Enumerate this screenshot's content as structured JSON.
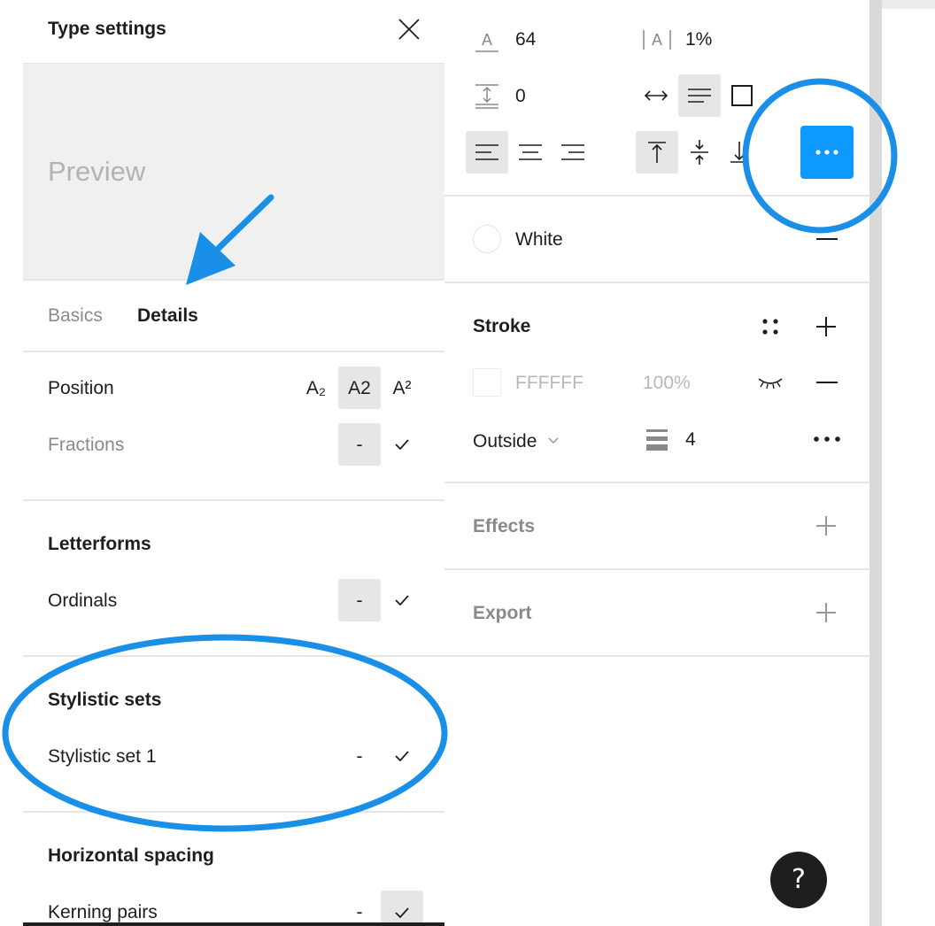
{
  "type_settings": {
    "title": "Type settings",
    "preview_text": "Preview",
    "tabs": [
      {
        "label": "Basics",
        "active": false
      },
      {
        "label": "Details",
        "active": true
      }
    ],
    "position": {
      "label": "Position",
      "options": [
        "A₂",
        "A2",
        "A²"
      ],
      "selected": "A2"
    },
    "fractions": {
      "label": "Fractions",
      "off": "-",
      "state": "off"
    },
    "letterforms": {
      "heading": "Letterforms",
      "ordinals": {
        "label": "Ordinals",
        "off": "-",
        "state": "off"
      }
    },
    "stylistic_sets": {
      "heading": "Stylistic sets",
      "set1": {
        "label": "Stylistic set 1",
        "off": "-",
        "state": "none"
      }
    },
    "horizontal_spacing": {
      "heading": "Horizontal spacing",
      "kerning_pairs": {
        "label": "Kerning pairs",
        "off": "-",
        "state": "on"
      }
    }
  },
  "text_props": {
    "font_size_value": "64",
    "letter_spacing_value": "1%",
    "line_height_value": "0",
    "auto_width_selected": true,
    "align_left_selected": true,
    "valign_top_selected": true
  },
  "fill": {
    "color_name": "White",
    "color_hex": "#ffffff"
  },
  "stroke": {
    "heading": "Stroke",
    "color_hex": "FFFFFF",
    "opacity": "100%",
    "position": "Outside",
    "weight": "4"
  },
  "effects": {
    "heading": "Effects"
  },
  "export": {
    "heading": "Export"
  },
  "help": {
    "label": "?"
  },
  "colors": {
    "accent": "#0d99ff",
    "annotation": "#1a8fe8",
    "selected_bg": "#e6e6e6",
    "divider": "#e6e6e6"
  }
}
